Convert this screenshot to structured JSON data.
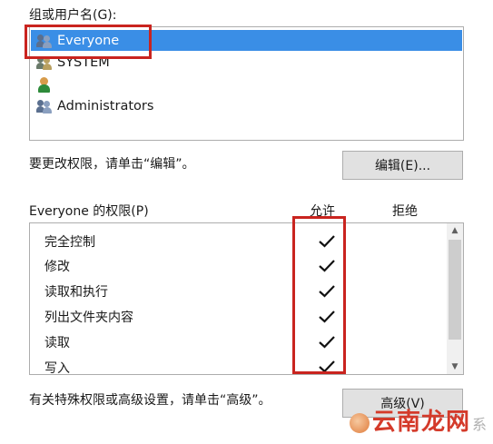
{
  "users_section": {
    "label": "组或用户名(G):",
    "users": [
      {
        "name": "Everyone",
        "icon": "group-icon",
        "selected": true
      },
      {
        "name": "SYSTEM",
        "icon": "group-icon",
        "selected": false
      },
      {
        "name": "",
        "icon": "user-icon",
        "selected": false
      },
      {
        "name": "Administrators",
        "icon": "group-icon",
        "selected": false
      }
    ]
  },
  "edit_section": {
    "hint": "要更改权限，请单击“编辑”。",
    "edit_button": "编辑(E)..."
  },
  "permissions_section": {
    "label": "Everyone 的权限(P)",
    "allow_header": "允许",
    "deny_header": "拒绝",
    "permissions": [
      {
        "name": "完全控制",
        "allow": true,
        "deny": false
      },
      {
        "name": "修改",
        "allow": true,
        "deny": false
      },
      {
        "name": "读取和执行",
        "allow": true,
        "deny": false
      },
      {
        "name": "列出文件夹内容",
        "allow": true,
        "deny": false
      },
      {
        "name": "读取",
        "allow": true,
        "deny": false
      },
      {
        "name": "写入",
        "allow": true,
        "deny": false
      }
    ]
  },
  "advanced_section": {
    "hint": "有关特殊权限或高级设置，请单击“高级”。",
    "advanced_button": "高级(V)"
  },
  "watermark": {
    "text": "云南龙网",
    "suffix": "系"
  },
  "colors": {
    "selection": "#3a8ee6",
    "highlight_border": "#c9241f"
  }
}
